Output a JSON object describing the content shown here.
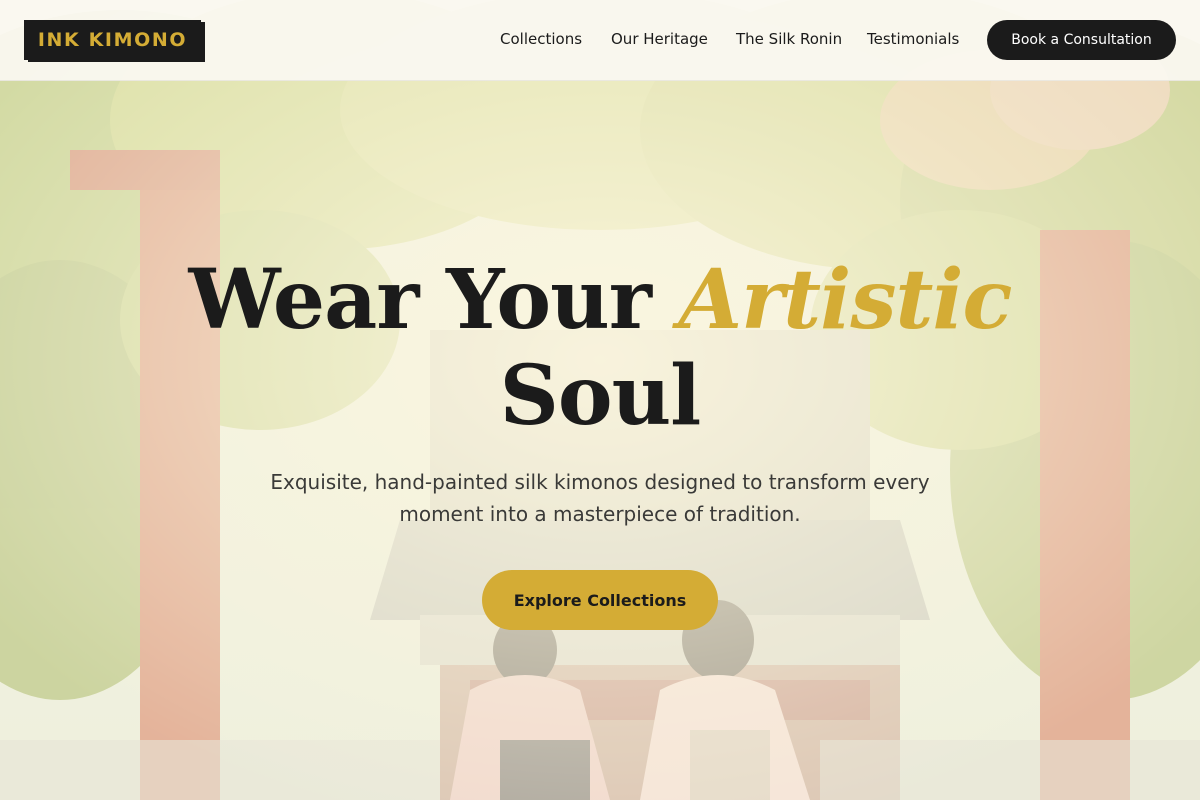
{
  "brand": {
    "logo_text": "INK KIMONO",
    "accent_color": "#d4ac35",
    "dark_color": "#1b1b1b"
  },
  "nav": {
    "links": [
      {
        "label": "Collections"
      },
      {
        "label": "Our Heritage"
      },
      {
        "label": "The Silk Ronin"
      },
      {
        "label": "Testimonials"
      }
    ],
    "cta_label": "Book a Consultation"
  },
  "hero": {
    "title_part1": "Wear Your",
    "title_accent": "Artistic",
    "title_part2": "Soul",
    "subtitle": "Exquisite, hand-painted silk kimonos designed to transform every moment into a masterpiece of tradition.",
    "cta_label": "Explore Collections"
  }
}
